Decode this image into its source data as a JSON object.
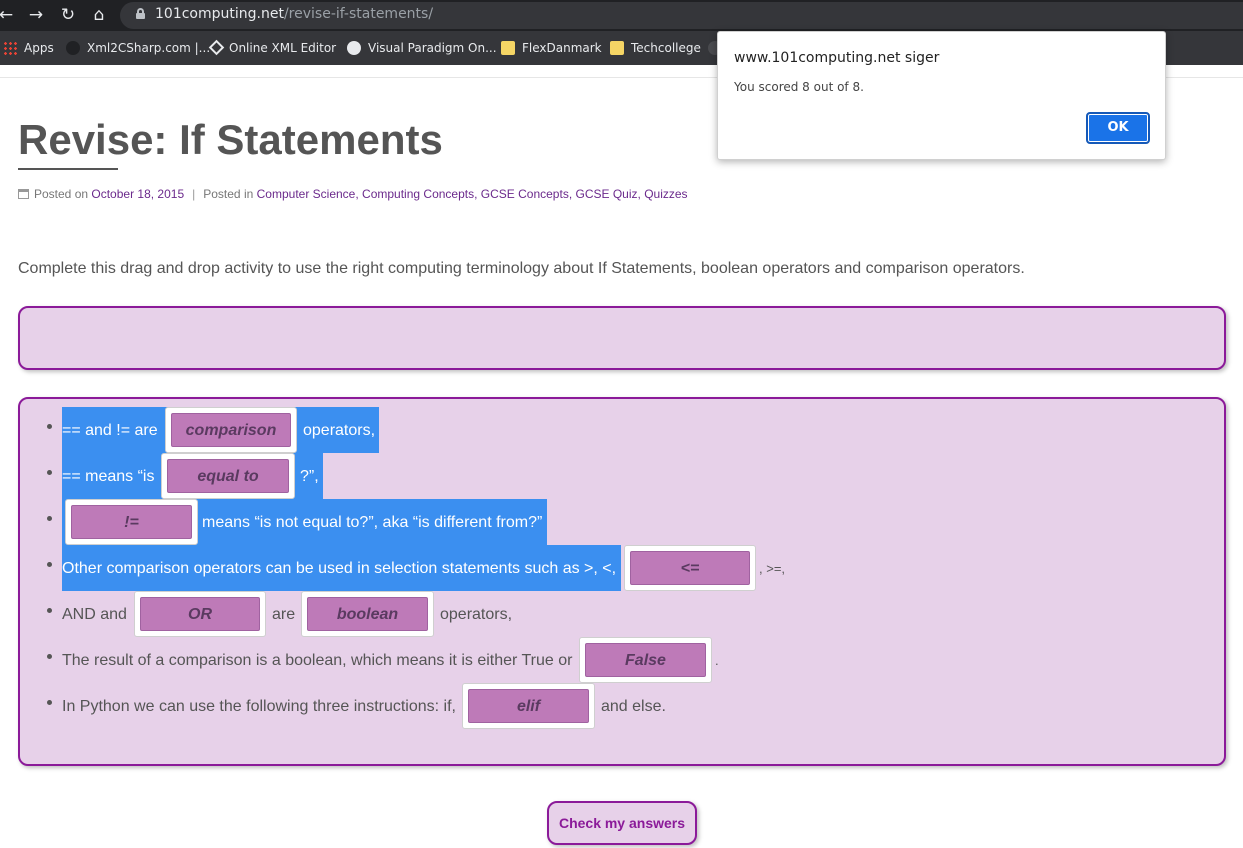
{
  "browser": {
    "url_domain": "101computing.net",
    "url_path": "/revise-if-statements/",
    "nav": {
      "back": "←",
      "forward": "→",
      "reload": "↻",
      "home": "⌂"
    },
    "bookmarks": [
      "Apps",
      "Xml2CSharp.com |...",
      "Online XML Editor",
      "Visual Paradigm On...",
      "FlexDanmark",
      "Techcollege"
    ]
  },
  "page": {
    "title": "Revise: If Statements",
    "meta": {
      "posted_on_label": "Posted on",
      "date": "October 18, 2015",
      "separator": "|",
      "posted_in_label": "Posted in",
      "categories": [
        "Computer Science,",
        "Computing Concepts,",
        "GCSE Concepts,",
        "GCSE Quiz,",
        "Quizzes"
      ]
    },
    "intro": "Complete this drag and drop activity to use the right computing terminology about If Statements, boolean operators and comparison operators.",
    "quiz": {
      "row1": {
        "pre": "== and != are",
        "answer": "comparison",
        "post": "operators,"
      },
      "row2": {
        "pre": "== means “is",
        "answer": "equal to",
        "post": "?”,"
      },
      "row3": {
        "answer": "!=",
        "post": "means “is not equal to?”, aka “is different from?”"
      },
      "row4": {
        "pre": "Other comparison operators can be used in selection statements such as >, <,",
        "answer": "<=",
        "post": ", >=,"
      },
      "row5": {
        "pre": "AND and",
        "answer1": "OR",
        "mid": "are",
        "answer2": "boolean",
        "post": "operators,"
      },
      "row6": {
        "pre": "The result of a comparison is a boolean, which means it is either True or",
        "answer": "False",
        "post": "."
      },
      "row7": {
        "pre": "In Python we can use the following three instructions: if,",
        "answer": "elif",
        "post": "and else."
      }
    },
    "check_button": "Check my answers"
  },
  "dialog": {
    "title": "www.101computing.net siger",
    "message": "You scored 8 out of 8.",
    "ok": "OK"
  },
  "colors": {
    "panel_bg": "#e7d1e9",
    "panel_border": "#8b1a99",
    "answer_tile": "#be7ab8",
    "selection": "#3b8ff0",
    "link": "#6b2a8c",
    "ok_button": "#1a73e8"
  }
}
